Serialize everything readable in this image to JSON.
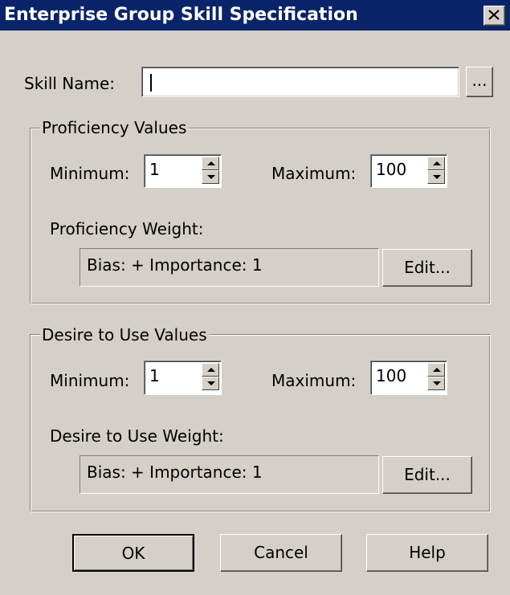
{
  "window": {
    "title": "Enterprise Group Skill Specification",
    "close_glyph": "✕"
  },
  "skill": {
    "label": "Skill Name:",
    "value": "",
    "browse_label": "..."
  },
  "proficiency": {
    "legend": "Proficiency Values",
    "min_label": "Minimum:",
    "min_value": "1",
    "max_label": "Maximum:",
    "max_value": "100",
    "weight_label": "Proficiency Weight:",
    "weight_text": "Bias: +   Importance: 1",
    "edit_label": "Edit..."
  },
  "desire": {
    "legend": "Desire to Use Values",
    "min_label": "Minimum:",
    "min_value": "1",
    "max_label": "Maximum:",
    "max_value": "100",
    "weight_label": "Desire to Use Weight:",
    "weight_text": "Bias: +   Importance: 1",
    "edit_label": "Edit..."
  },
  "buttons": {
    "ok": "OK",
    "cancel": "Cancel",
    "help": "Help"
  },
  "colors": {
    "titlebar": "#0a246a",
    "face": "#d4d0c8"
  }
}
